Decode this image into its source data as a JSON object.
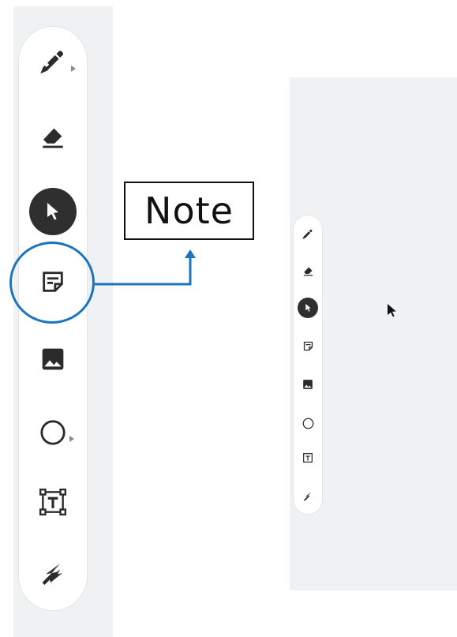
{
  "annotation": {
    "label": "Note",
    "accent_color": "#1b74bf"
  },
  "toolbar": {
    "tools": [
      {
        "name": "pen-tool",
        "icon": "pen-icon",
        "has_submenu": true
      },
      {
        "name": "eraser-tool",
        "icon": "eraser-icon",
        "has_submenu": false
      },
      {
        "name": "select-tool",
        "icon": "pointer-icon",
        "active": true
      },
      {
        "name": "note-tool",
        "icon": "sticky-note-icon",
        "has_submenu": false
      },
      {
        "name": "image-tool",
        "icon": "image-icon",
        "has_submenu": false
      },
      {
        "name": "shape-tool",
        "icon": "circle-icon",
        "has_submenu": true
      },
      {
        "name": "text-tool",
        "icon": "text-box-icon",
        "has_submenu": false
      },
      {
        "name": "laser-tool",
        "icon": "laser-icon",
        "has_submenu": false
      }
    ]
  },
  "colors": {
    "panel_background": "#f0f1f3",
    "toolbar_background": "#ffffff",
    "active_tool": "#2f2f2f",
    "icon": "#2b2b2b"
  }
}
